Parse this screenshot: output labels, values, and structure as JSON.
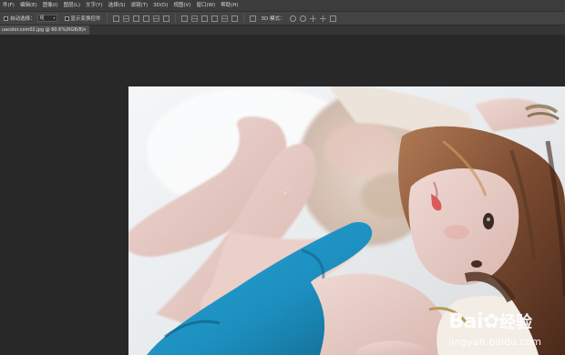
{
  "menubar": {
    "items": [
      "件(F)",
      "编辑(E)",
      "图像(I)",
      "图层(L)",
      "文字(Y)",
      "选择(S)",
      "滤镜(T)",
      "3D(D)",
      "视图(V)",
      "窗口(W)",
      "帮助(H)"
    ]
  },
  "options": {
    "auto_select_label": "自动选择：",
    "auto_select_value": "组",
    "show_transform_label": "显示变换控件",
    "mode_3d_label": "3D 模式："
  },
  "document": {
    "tab_title": "uacolor.com02.jpg @ 60.6%(RGB/8)",
    "close_glyph": "×"
  },
  "watermark": {
    "brand": "Bai",
    "brand_cn": "经验",
    "url": "jingyan.baidu.com"
  },
  "colors": {
    "menubar_bg": "#3c3c3c",
    "options_bg": "#434343",
    "canvas_bg": "#282828",
    "dress_blue": "#1c8fbf"
  }
}
